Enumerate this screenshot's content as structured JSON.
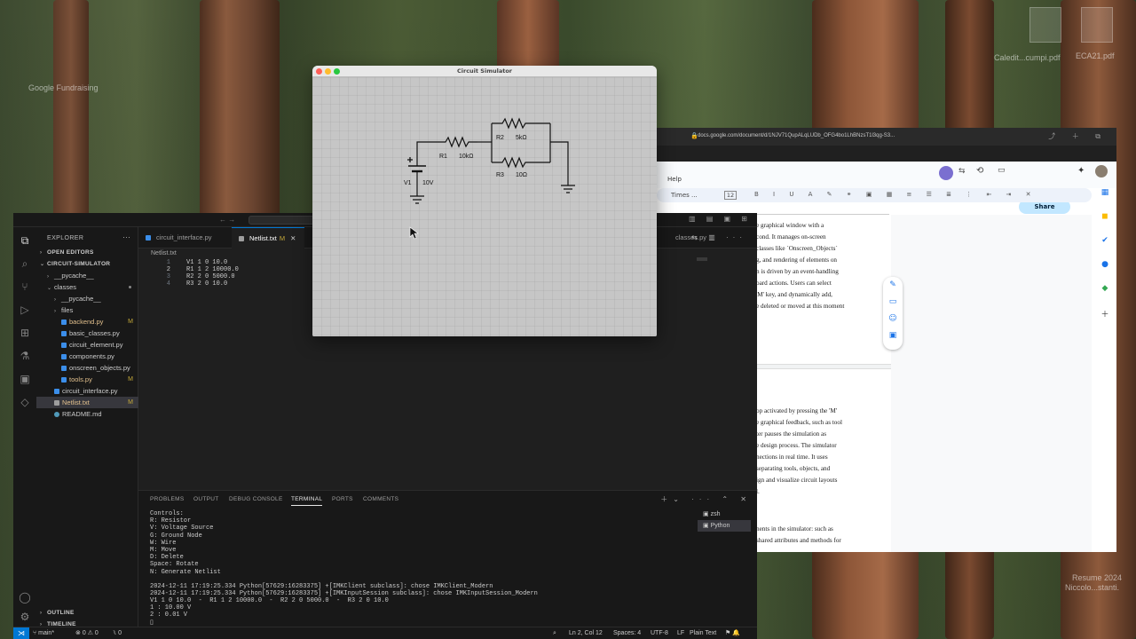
{
  "desktop": {
    "labels": [
      "Google Fundraising",
      "Caledit...cumpi.pdf",
      "ECA21.pdf",
      "Resume 2024",
      "Niccolo...stanti."
    ]
  },
  "simulator": {
    "title": "Circuit Simulator",
    "components": {
      "r1_name": "R1",
      "r1_value": "10kΩ",
      "r2_name": "R2",
      "r2_value": "5kΩ",
      "r3_name": "R3",
      "r3_value": "10Ω",
      "v1_name": "V1",
      "v1_value": "10V"
    }
  },
  "vscode": {
    "explorer_title": "EXPLORER",
    "sections": {
      "open_editors": "OPEN EDITORS",
      "project": "CIRCUIT-SIMULATOR",
      "outline": "OUTLINE",
      "timeline": "TIMELINE"
    },
    "tree": [
      {
        "label": "__pycache__",
        "depth": 1,
        "folder": true,
        "badge": ""
      },
      {
        "label": "classes",
        "depth": 1,
        "folder": true,
        "badge": "",
        "open": true
      },
      {
        "label": "__pycache__",
        "depth": 2,
        "folder": true,
        "badge": ""
      },
      {
        "label": "files",
        "depth": 2,
        "folder": true,
        "badge": ""
      },
      {
        "label": "backend.py",
        "depth": 2,
        "folder": false,
        "badge": "M"
      },
      {
        "label": "basic_classes.py",
        "depth": 2,
        "folder": false,
        "badge": ""
      },
      {
        "label": "circuit_element.py",
        "depth": 2,
        "folder": false,
        "badge": ""
      },
      {
        "label": "components.py",
        "depth": 2,
        "folder": false,
        "badge": ""
      },
      {
        "label": "onscreen_objects.py",
        "depth": 2,
        "folder": false,
        "badge": ""
      },
      {
        "label": "tools.py",
        "depth": 2,
        "folder": false,
        "badge": "M"
      },
      {
        "label": "circuit_interface.py",
        "depth": 1,
        "folder": false,
        "badge": ""
      },
      {
        "label": "Netlist.txt",
        "depth": 1,
        "folder": false,
        "badge": "M",
        "selected": true
      },
      {
        "label": "README.md",
        "depth": 1,
        "folder": false,
        "badge": ""
      }
    ],
    "tabs": [
      {
        "label": "circuit_interface.py",
        "modified": ""
      },
      {
        "label": "Netlist.txt",
        "modified": "M",
        "active": true
      },
      {
        "label": "classes.py",
        "modified": ""
      }
    ],
    "breadcrumb": "Netlist.txt",
    "code_lines": [
      {
        "n": "1",
        "text": "V1 1 0 10.0"
      },
      {
        "n": "2",
        "text": "R1 1 2 10000.0"
      },
      {
        "n": "3",
        "text": "R2 2 0 5000.0"
      },
      {
        "n": "4",
        "text": "R3 2 0 10.0"
      }
    ],
    "panel_tabs": [
      "PROBLEMS",
      "OUTPUT",
      "DEBUG CONSOLE",
      "TERMINAL",
      "PORTS",
      "COMMENTS"
    ],
    "terminal_lines": [
      "Controls:",
      "R: Resistor",
      "V: Voltage Source",
      "G: Ground Node",
      "W: Wire",
      "M: Move",
      "D: Delete",
      "Space: Rotate",
      "N: Generate Netlist"
    ],
    "terminal_lines2": [
      "2024-12-11 17:19:25.334 Python[57629:16283375] +[IMKClient subclass]: chose IMKClient_Modern",
      "2024-12-11 17:19:25.334 Python[57629:16283375] +[IMKInputSession subclass]: chose IMKInputSession_Modern",
      "V1 1 0 10.0  -  R1 1 2 10000.0  -  R2 2 0 5000.0  -  R3 2 0 10.0",
      "1 : 10.00 V",
      "2 : 0.01 V",
      "▯"
    ],
    "terminal_sessions": [
      "zsh",
      "Python"
    ],
    "status": {
      "branch": "main*",
      "errors": "0",
      "warnings": "0",
      "ports": "0",
      "cursor": "Ln 2, Col 12",
      "spaces": "Spaces: 4",
      "encoding": "UTF-8",
      "eol": "LF",
      "language": "Plain Text"
    }
  },
  "browser": {
    "url": "docs.google.com/document/d/1NJV71QupALqLUDb_OFG4bo1LhBNzsT1l3qg-S3...",
    "menu_help": "Help",
    "font": "Times ...",
    "font_size": "12",
    "share": "Share",
    "doc_lines_page1": [
      "e graphical window with a",
      "cond. It manages on-screen",
      " classes like `Onscreen_Objects`",
      "g, and rendering of elements on",
      "n is driven by an event-handling",
      "oard actions. Users can select",
      "'M' key, and dynamically add,",
      "e deleted or moved at this moment"
    ],
    "doc_lines_page2": [
      "op activated by pressing the 'M'",
      "e graphical feedback, such as tool",
      "ter pauses the simulation as",
      "e design process. The simulator",
      "nections in real time. It uses",
      "separating tools, objects, and",
      "ign and visualize circuit layouts",
      "l."
    ],
    "doc_lines_page3": [
      "nents in the simulator: such as",
      "shared attributes and methods for"
    ]
  }
}
